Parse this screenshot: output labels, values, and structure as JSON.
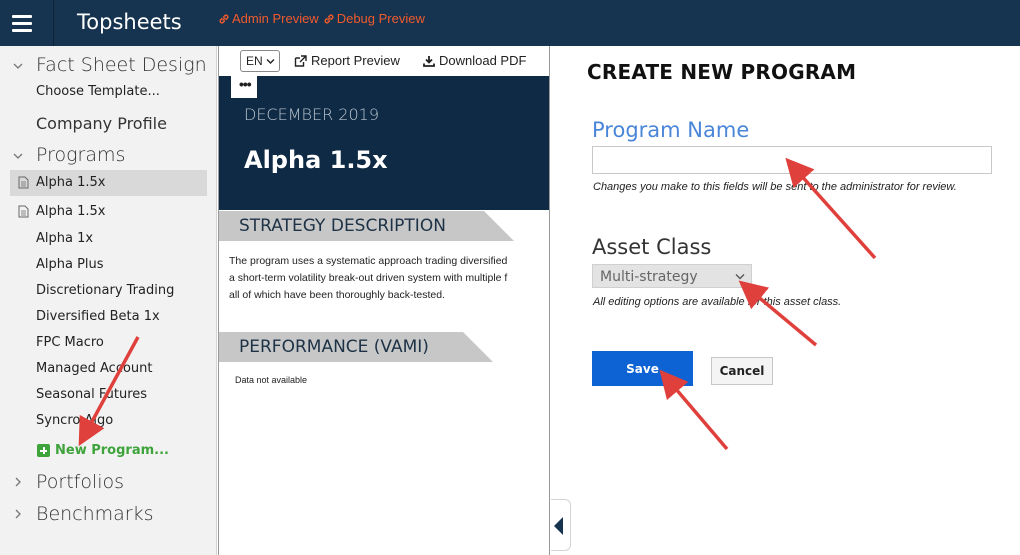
{
  "header": {
    "app_title": "Topsheets",
    "links": [
      "Admin Preview",
      "Debug Preview"
    ]
  },
  "sidebar": {
    "sections": {
      "fact_sheet_design": "Fact Sheet Design",
      "programs": "Programs",
      "portfolios": "Portfolios",
      "benchmarks": "Benchmarks"
    },
    "fact_sheet_items": [
      "Choose Template...",
      "Company Profile"
    ],
    "program_items": [
      "Alpha 1.5x",
      "Alpha 1.5x",
      "Alpha 1x",
      "Alpha Plus",
      "Discretionary Trading",
      "Diversified Beta 1x",
      "FPC Macro",
      "Managed Account",
      "Seasonal Futures",
      "Syncro Algo"
    ],
    "new_program": "New Program..."
  },
  "preview": {
    "language": "EN",
    "report_preview": "Report Preview",
    "download_pdf": "Download PDF",
    "more": "•••",
    "date": "DECEMBER 2019",
    "title": "Alpha 1.5x",
    "strategy_heading": "STRATEGY DESCRIPTION",
    "strategy_lines": [
      "The program uses a systematic approach trading diversified",
      "a short-term volatility break-out driven system with multiple f",
      "all of which have been thoroughly back-tested."
    ],
    "performance_heading": "PERFORMANCE (VAMI)",
    "no_data": "Data not available"
  },
  "form": {
    "title": "CREATE NEW PROGRAM",
    "program_name_label": "Program Name",
    "program_name_value": "",
    "program_name_help": "Changes you make to this fields will be sent to the administrator for review.",
    "asset_class_label": "Asset Class",
    "asset_class_value": "Multi-strategy",
    "asset_class_help": "All editing options are available for this asset class.",
    "save": "Save",
    "cancel": "Cancel"
  },
  "colors": {
    "topbar": "#163350",
    "accent_link": "#f25a2c",
    "new_program": "#3ea33a",
    "primary_button": "#0e63d4",
    "label_blue": "#4a86d8",
    "annotation_arrow": "#e0403c"
  }
}
